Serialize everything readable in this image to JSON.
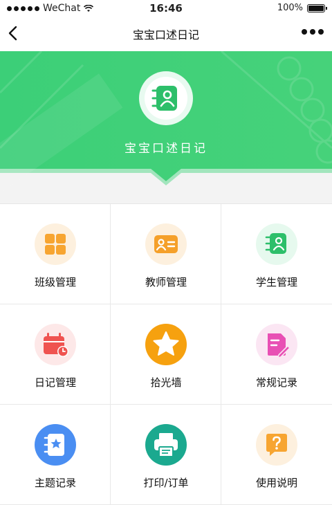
{
  "status_bar": {
    "carrier": "WeChat",
    "time": "16:46",
    "battery": "100%"
  },
  "navbar": {
    "title": "宝宝口述日记"
  },
  "hero": {
    "title": "宝宝口述日记"
  },
  "menu": [
    {
      "label": "班级管理",
      "icon": "class-grid-icon"
    },
    {
      "label": "教师管理",
      "icon": "teacher-card-icon"
    },
    {
      "label": "学生管理",
      "icon": "student-notebook-icon"
    },
    {
      "label": "日记管理",
      "icon": "calendar-clock-icon"
    },
    {
      "label": "拾光墙",
      "icon": "star-icon"
    },
    {
      "label": "常规记录",
      "icon": "document-edit-icon"
    },
    {
      "label": "主题记录",
      "icon": "star-notebook-icon"
    },
    {
      "label": "打印/订单",
      "icon": "printer-icon"
    },
    {
      "label": "使用说明",
      "icon": "question-bubble-icon"
    }
  ],
  "colors": {
    "hero_green": "#3ccf78",
    "accent_green": "#2dbf6a",
    "orange": "#f7a531",
    "red": "#ef5350",
    "pink": "#e84fb4",
    "blue": "#4a8ef2",
    "teal": "#1ba98f"
  }
}
